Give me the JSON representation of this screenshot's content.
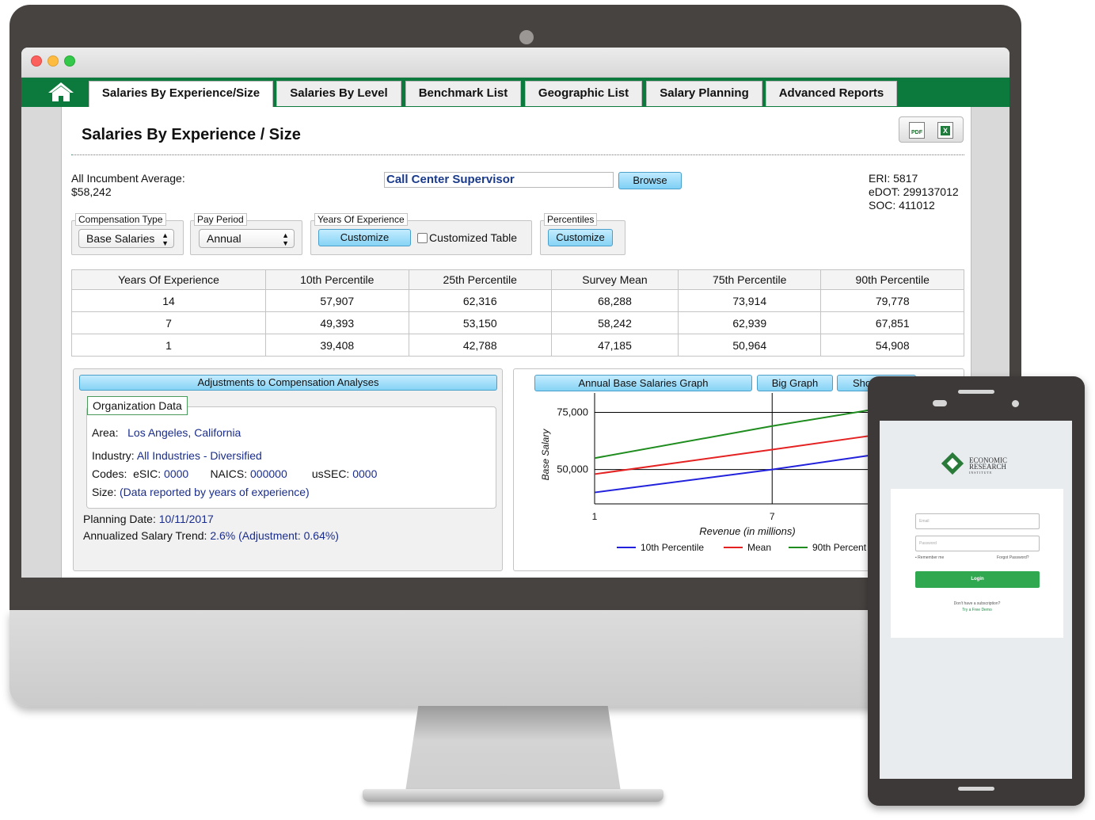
{
  "window": {
    "controls": [
      "close",
      "minimize",
      "zoom"
    ]
  },
  "nav": {
    "home_icon": "home-icon",
    "tabs": [
      {
        "label": "Salaries By Experience/Size",
        "active": true
      },
      {
        "label": "Salaries By Level"
      },
      {
        "label": "Benchmark List"
      },
      {
        "label": "Geographic List"
      },
      {
        "label": "Salary Planning"
      },
      {
        "label": "Advanced Reports"
      }
    ]
  },
  "page": {
    "title": "Salaries By Experience / Size",
    "export_icons": [
      "pdf-icon",
      "excel-icon"
    ],
    "pdf_label": "PDF",
    "excel_label": "X"
  },
  "summary": {
    "avg_label": "All Incumbent Average:",
    "avg_value": "$58,242",
    "job_title": "Call Center Supervisor",
    "browse": "Browse",
    "eri": "ERI: 5817",
    "edot": "eDOT: 299137012",
    "soc": "SOC: 411012"
  },
  "filters": {
    "compensation": {
      "legend": "Compensation Type",
      "value": "Base Salaries"
    },
    "pay_period": {
      "legend": "Pay Period",
      "value": "Annual"
    },
    "experience": {
      "legend": "Years Of Experience",
      "button": "Customize",
      "checkbox_label": "Customized Table",
      "checked": false
    },
    "percentiles": {
      "legend": "Percentiles",
      "button": "Customize"
    }
  },
  "table": {
    "headers": [
      "Years Of Experience",
      "10th Percentile",
      "25th Percentile",
      "Survey Mean",
      "75th Percentile",
      "90th Percentile"
    ],
    "rows": [
      [
        "14",
        "57,907",
        "62,316",
        "68,288",
        "73,914",
        "79,778"
      ],
      [
        "7",
        "49,393",
        "53,150",
        "58,242",
        "62,939",
        "67,851"
      ],
      [
        "1",
        "39,408",
        "42,788",
        "47,185",
        "50,964",
        "54,908"
      ]
    ]
  },
  "adjustments": {
    "header": "Adjustments to Compensation Analyses",
    "org_legend": "Organization Data",
    "area_label": "Area:",
    "area_value": "Los Angeles, California",
    "industry_label": "Industry:",
    "industry_value": "All Industries - Diversified",
    "codes_label": "Codes:",
    "esic_label": "eSIC:",
    "esic_value": "0000",
    "naics_label": "NAICS:",
    "naics_value": "000000",
    "ussec_label": "usSEC:",
    "ussec_value": "0000",
    "size_label": "Size:",
    "size_value": "(Data reported by years of experience)",
    "planning_label": "Planning Date:",
    "planning_value": "10/11/2017",
    "trend_label": "Annualized Salary Trend:",
    "trend_value": "2.6% (Adjustment: 0.64%)"
  },
  "graph": {
    "buttons": [
      "Annual Base Salaries Graph",
      "Big Graph",
      "Sho"
    ]
  },
  "chart_data": {
    "type": "line",
    "xlabel": "Revenue (in millions)",
    "ylabel": "Base Salary",
    "x_ticks": [
      "1",
      "7"
    ],
    "y_ticks": [
      "75,000",
      "50,000"
    ],
    "x": [
      1,
      7,
      11
    ],
    "series": [
      {
        "name": "10th Percentile",
        "color": "#2222dd",
        "values": [
          40000,
          50000,
          57500
        ]
      },
      {
        "name": "Mean",
        "color": "#e52222",
        "values": [
          48000,
          58700,
          66000
        ]
      },
      {
        "name": "90th Percent",
        "color": "#1e8c1e",
        "values": [
          55000,
          69000,
          77500
        ]
      }
    ],
    "ylim": [
      35000,
      80000
    ]
  },
  "mobile": {
    "logo_line1": "ECONOMIC",
    "logo_line2": "RESEARCH",
    "logo_line3": "INSTITUTE",
    "email_placeholder": "Email",
    "password_placeholder": "Password",
    "remember": "Remember me",
    "forgot": "Forgot Password?",
    "login": "Login",
    "no_sub": "Don't have a subscription?",
    "demo": "Try a Free Demo"
  }
}
